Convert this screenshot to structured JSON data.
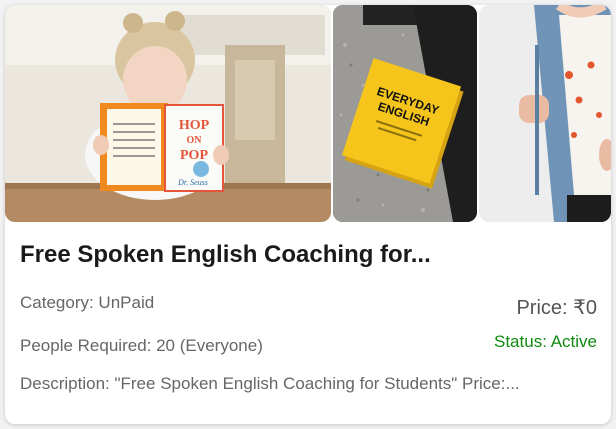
{
  "listing": {
    "title": "Free Spoken English Coaching for...",
    "category": "Category: UnPaid",
    "price": "Price: ₹0",
    "people_required": "People Required: 20 (Everyone)",
    "status": "Status: Active",
    "description": "Description: \"Free Spoken English Coaching for Students\" Price:..."
  },
  "images": {
    "book1": {
      "title_top": "HOP",
      "title_mid": "ON",
      "title_bot": "POP",
      "author": "Dr. Seuss"
    },
    "book2": {
      "line1": "EVERYDAY",
      "line2": "ENGLISH"
    }
  },
  "colors": {
    "status_active": "#118a11",
    "book_yellow": "#f5c51c",
    "denim": "#6f94b8"
  }
}
